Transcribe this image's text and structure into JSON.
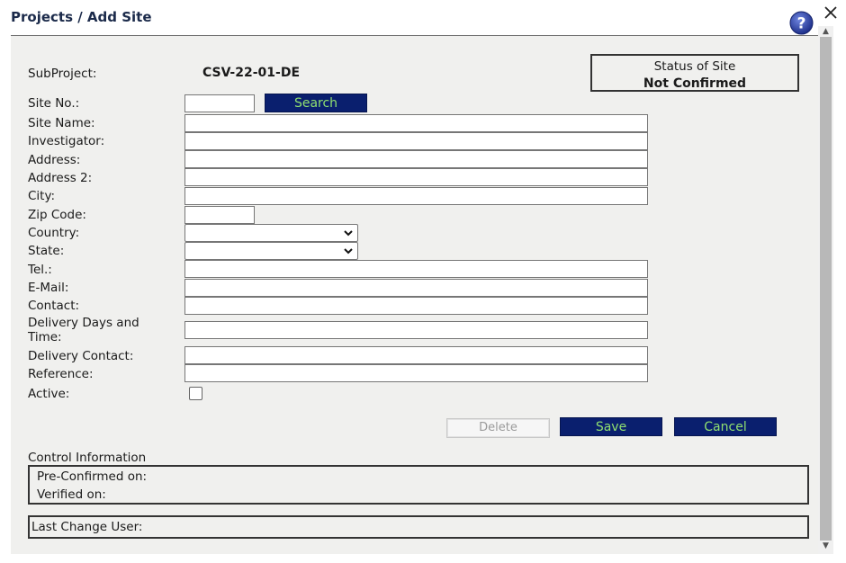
{
  "dialog": {
    "title": "Projects / Add Site"
  },
  "form": {
    "subproject_label": "SubProject:",
    "subproject_value": "CSV-22-01-DE",
    "site_no_label": "Site No.:",
    "site_no_value": "",
    "search_label": "Search",
    "site_name_label": "Site Name:",
    "investigator_label": "Investigator:",
    "address_label": "Address:",
    "address2_label": "Address 2:",
    "city_label": "City:",
    "zip_label": "Zip Code:",
    "country_label": "Country:",
    "country_value": "",
    "state_label": "State:",
    "state_value": "",
    "tel_label": "Tel.:",
    "email_label": "E-Mail:",
    "contact_label": "Contact:",
    "delivery_days_label_line1": "Delivery Days and",
    "delivery_days_label_line2": "Time:",
    "delivery_contact_label": "Delivery Contact:",
    "reference_label": "Reference:",
    "active_label": "Active:",
    "active_checked": false
  },
  "status": {
    "title": "Status of Site",
    "value": "Not Confirmed"
  },
  "actions": {
    "delete_label": "Delete",
    "save_label": "Save",
    "cancel_label": "Cancel"
  },
  "control_info": {
    "heading": "Control Information",
    "pre_confirmed_label": "Pre-Confirmed on:",
    "verified_label": "Verified on:",
    "last_change_label": "Last Change User:"
  },
  "icons": {
    "help": "help-icon",
    "close": "close-icon"
  },
  "colors": {
    "button_bg": "#0a1f6e",
    "button_text": "#90e070",
    "panel_bg": "#f0f0ee",
    "help_icon": "#2b3f9e"
  }
}
